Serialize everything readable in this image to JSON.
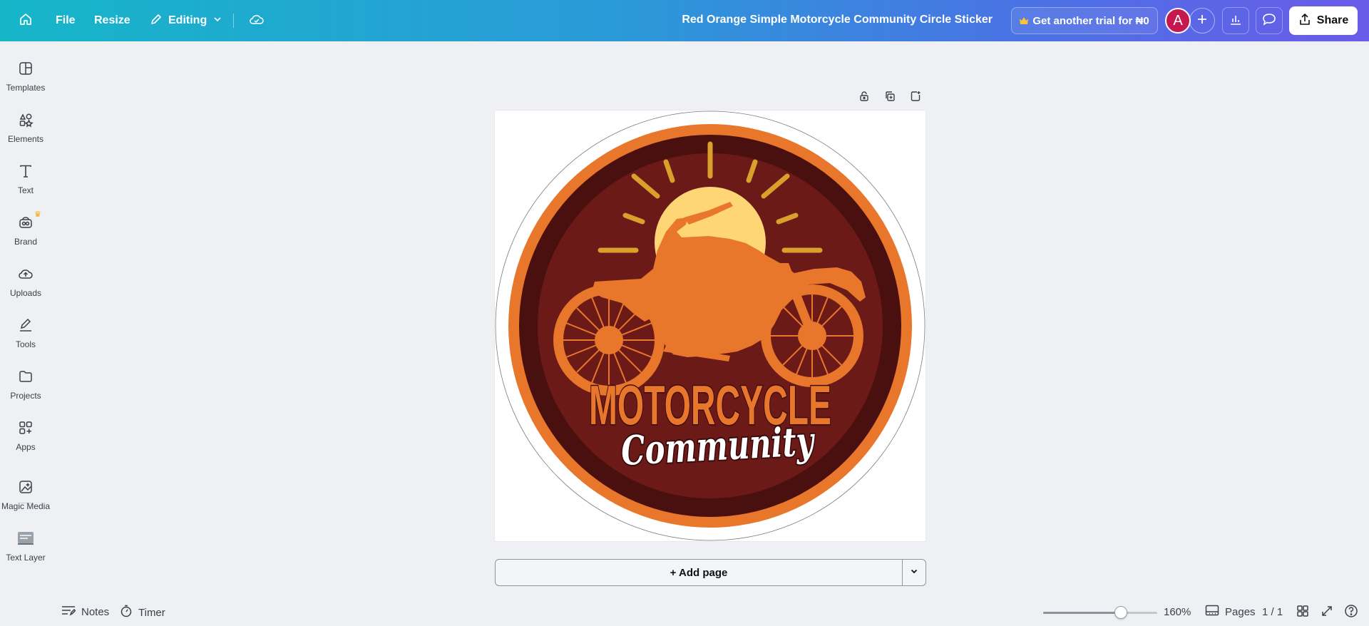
{
  "topbar": {
    "file_label": "File",
    "resize_label": "Resize",
    "editing_label": "Editing",
    "document_title": "Red Orange Simple Motorcycle Community Circle Sticker",
    "trial_label": "Get another trial for ₦0",
    "avatar_initial": "A",
    "share_label": "Share"
  },
  "sidebar": {
    "items": [
      {
        "label": "Templates",
        "icon": "templates-icon"
      },
      {
        "label": "Elements",
        "icon": "elements-icon"
      },
      {
        "label": "Text",
        "icon": "text-icon"
      },
      {
        "label": "Brand",
        "icon": "brand-icon"
      },
      {
        "label": "Uploads",
        "icon": "uploads-icon"
      },
      {
        "label": "Tools",
        "icon": "tools-icon"
      },
      {
        "label": "Projects",
        "icon": "projects-icon"
      },
      {
        "label": "Apps",
        "icon": "apps-icon"
      },
      {
        "label": "Magic Media",
        "icon": "magic-media-icon"
      },
      {
        "label": "Text Layer",
        "icon": "text-layer-icon"
      }
    ]
  },
  "design": {
    "headline": "MOTORCYCLE",
    "subline": "Community",
    "colors": {
      "outer_ring": "#e8772c",
      "dark_ring": "#4a1010",
      "inner_fill": "#6b1a17",
      "sun": "#ffd676",
      "rays": "#d9a12c",
      "bike": "#e8772c"
    }
  },
  "canvas": {
    "add_page_label": "+ Add page"
  },
  "bottombar": {
    "notes_label": "Notes",
    "timer_label": "Timer",
    "zoom_value": 160,
    "zoom_label": "160%",
    "zoom_fraction": 0.68,
    "pages_label": "Pages",
    "page_count": "1 / 1"
  }
}
